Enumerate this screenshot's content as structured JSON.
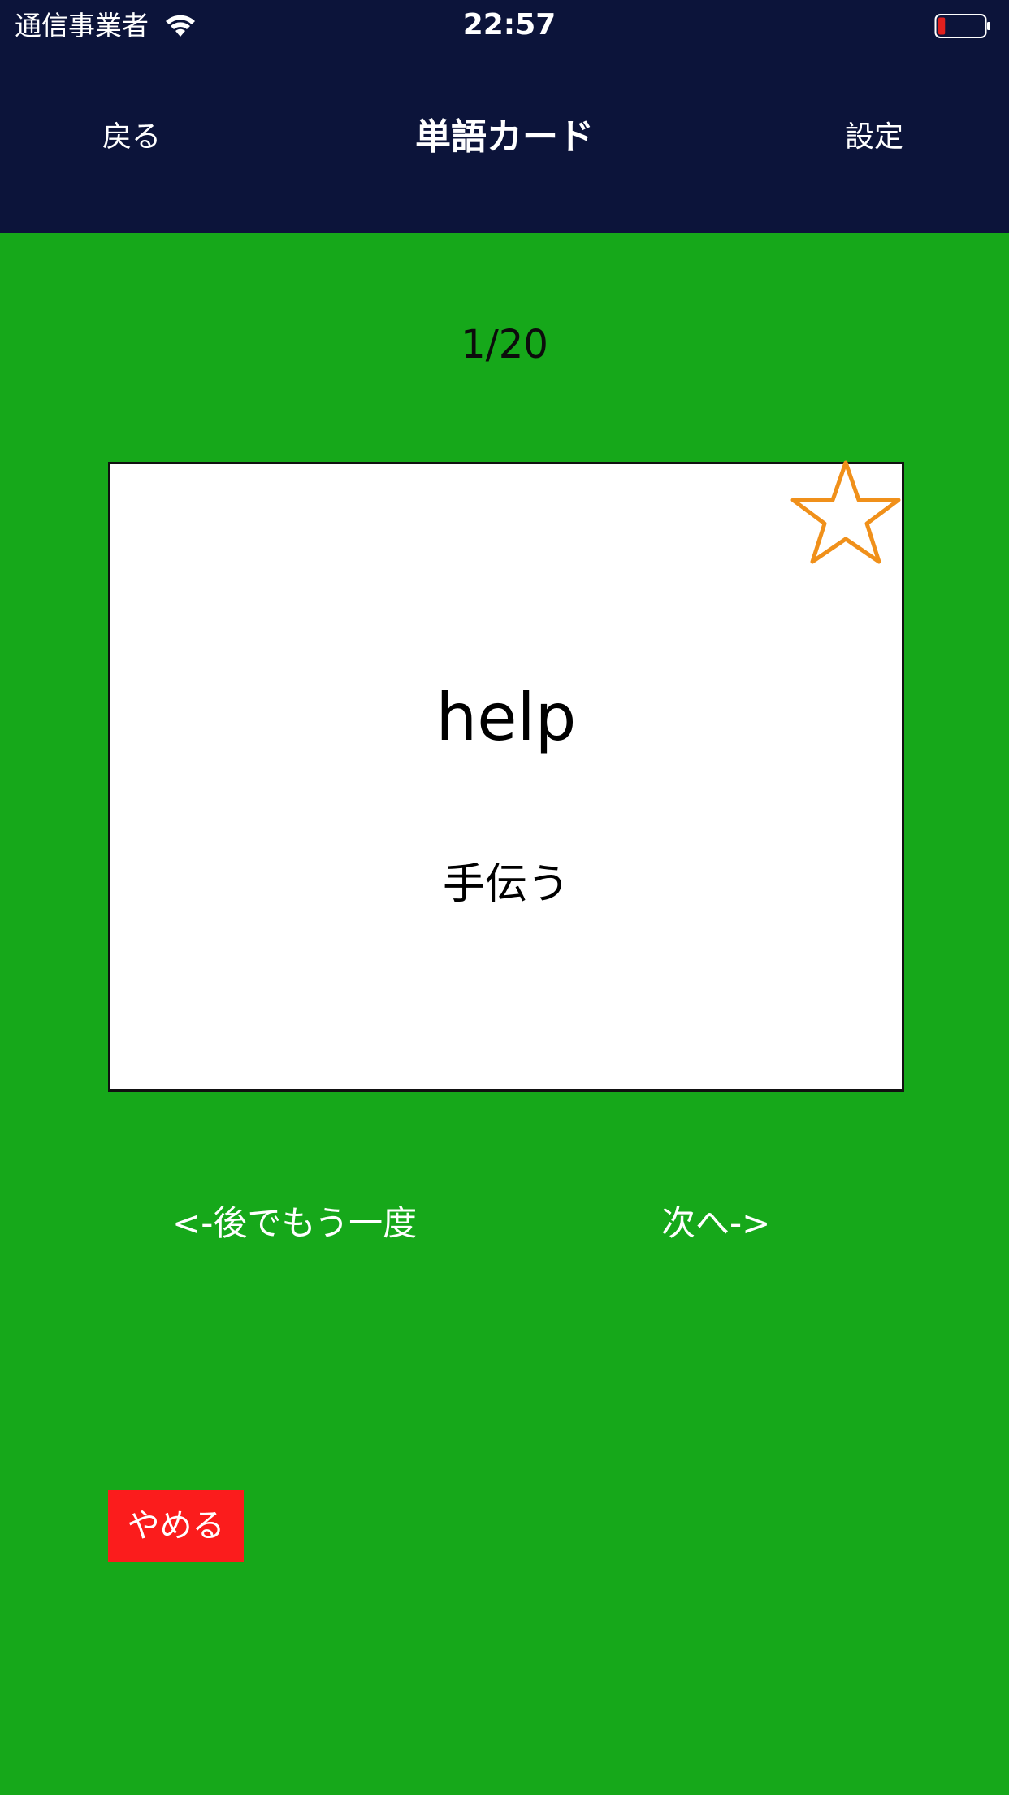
{
  "status_bar": {
    "carrier": "通信事業者",
    "time": "22:57",
    "wifi_icon": "wifi-icon",
    "battery_icon": "battery-low-icon",
    "battery_level": 0.15,
    "battery_color": "#e0201e"
  },
  "nav": {
    "back_label": "戻る",
    "title": "単語カード",
    "settings_label": "設定"
  },
  "progress": {
    "counter": "1/20"
  },
  "card": {
    "word": "help",
    "meaning": "手伝う",
    "star_icon": "star-outline-icon",
    "star_color": "#f0901a"
  },
  "actions": {
    "later_label": "<-後でもう一度",
    "next_label": "次へ->",
    "quit_label": "やめる"
  },
  "colors": {
    "header_bg": "#0c143a",
    "body_bg": "#16a81a",
    "quit_bg": "#fb1c1c"
  }
}
